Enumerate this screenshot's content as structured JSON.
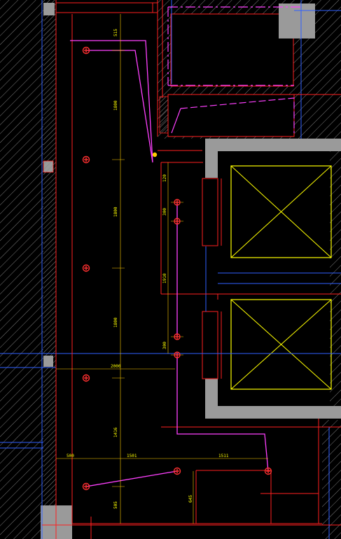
{
  "drawing": {
    "colors": {
      "background": "#000000",
      "wall_hatch": "#8a8a8a",
      "wall_fill": "#9a9a9a",
      "red_line": "#ff2020",
      "magenta_line": "#ff40ff",
      "blue_line": "#3060ff",
      "yellow_line": "#ffff00",
      "dim_line": "#ffcc00",
      "light_fixture": "#ff3030"
    },
    "elevator_symbol": "elevator-cross-box",
    "light_symbol": "circle-cross-fixture",
    "dimensions": {
      "top_gap": "515",
      "segment_a": "1800",
      "segment_b": "1800",
      "segment_c": "1800",
      "bottom_segment": "1416",
      "bottom_gap": "505",
      "span_width": "2000",
      "small_a": "300",
      "small_b": "300",
      "wall_gap": "120",
      "lobby_height": "1910",
      "h_left": "500",
      "h_mid": "1501",
      "h_right": "1511",
      "right_drop": "645"
    }
  }
}
